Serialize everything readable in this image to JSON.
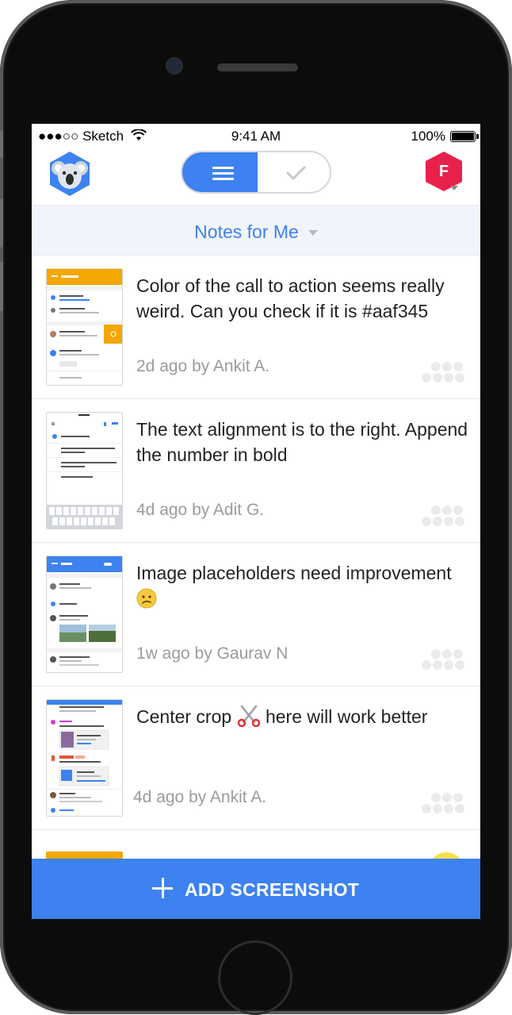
{
  "status_bar": {
    "carrier": "●●●○○ Sketch",
    "time": "9:41 AM",
    "battery": "100%"
  },
  "header": {
    "logo_icon": "koala-logo-icon",
    "toggle": {
      "left_icon": "list-icon",
      "right_icon": "checkmark-icon",
      "active": "left"
    },
    "avatar_letter": "F",
    "colors": {
      "accent": "#3d82f0",
      "avatar": "#e8214a"
    }
  },
  "filter": {
    "label": "Notes for Me",
    "caret_icon": "chevron-down-icon"
  },
  "notes": [
    {
      "text": "Color of the call to action seems really weird. Can you check if it is #aaf345",
      "meta": "2d ago by Ankit A."
    },
    {
      "text": "The text alignment is to the right. Append the number in bold",
      "meta": "4d ago by Adit G."
    },
    {
      "text": "Image placeholders need improvement",
      "emoji": "confused-face-icon",
      "meta": "1w ago by Gaurav N"
    },
    {
      "text_before": "Center crop",
      "emoji": "scissors-icon",
      "text_after": "here will work better",
      "meta": "4d ago by Ankit A."
    }
  ],
  "fab": {
    "label": "ADD SCREENSHOT",
    "icon": "plus-icon"
  }
}
